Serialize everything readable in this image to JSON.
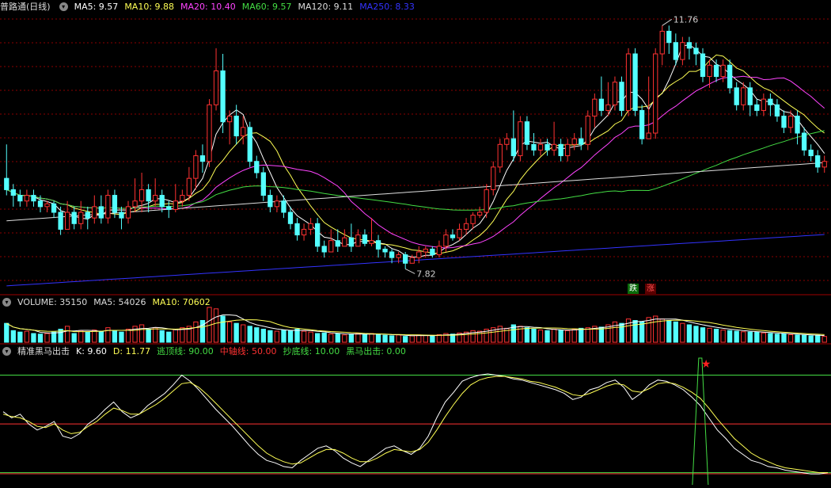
{
  "main": {
    "name": "普路通(日线)",
    "ma": [
      {
        "label": "MA5: 9.57",
        "color": "#ffffff"
      },
      {
        "label": "MA10: 9.88",
        "color": "#ffff55"
      },
      {
        "label": "MA20: 10.40",
        "color": "#ff44ff"
      },
      {
        "label": "MA60: 9.57",
        "color": "#44dd44"
      },
      {
        "label": "MA120: 9.11",
        "color": "#dddddd"
      },
      {
        "label": "MA250: 8.33",
        "color": "#3333ff"
      }
    ],
    "high_label": "11.76",
    "low_label": "7.82"
  },
  "volume": {
    "label": "VOLUME: 35150",
    "ma5": "MA5: 54026",
    "ma10": "MA10: 70602"
  },
  "indicator": {
    "name": "精准黑马出击",
    "k": "K: 9.60",
    "d": "D: 11.77",
    "top": "逃顶线: 90.00",
    "mid": "中轴线: 50.00",
    "bottom": "抄底线: 10.00",
    "signal": "黑马出击: 0.00"
  },
  "badges": {
    "down": "跌",
    "up": "涨"
  },
  "colors": {
    "up": "#ff3232",
    "down": "#54ffff",
    "grid": "#8b0000",
    "bg": "#000000"
  },
  "chart_data": {
    "type": "candlestick",
    "ylim": [
      7.2,
      12.1
    ],
    "candles": [
      [
        9.2,
        9.0,
        9.8,
        8.9
      ],
      [
        9.0,
        8.9,
        9.1,
        8.7
      ],
      [
        8.9,
        8.8,
        9.0,
        8.7
      ],
      [
        8.8,
        8.9,
        9.0,
        8.7
      ],
      [
        8.9,
        8.8,
        9.0,
        8.7
      ],
      [
        8.8,
        8.7,
        8.9,
        8.6
      ],
      [
        8.7,
        8.75,
        8.8,
        8.6
      ],
      [
        8.75,
        8.6,
        8.8,
        8.5
      ],
      [
        8.6,
        8.3,
        8.7,
        8.2
      ],
      [
        8.3,
        8.6,
        8.8,
        8.3
      ],
      [
        8.6,
        8.4,
        8.7,
        8.3
      ],
      [
        8.4,
        8.6,
        8.8,
        8.3
      ],
      [
        8.6,
        8.5,
        8.7,
        8.3
      ],
      [
        8.5,
        8.7,
        8.9,
        8.4
      ],
      [
        8.7,
        8.5,
        8.9,
        8.4
      ],
      [
        8.5,
        8.9,
        9.0,
        8.4
      ],
      [
        8.9,
        8.6,
        9.0,
        8.5
      ],
      [
        8.6,
        8.5,
        8.7,
        8.3
      ],
      [
        8.5,
        8.7,
        8.8,
        8.4
      ],
      [
        8.7,
        8.8,
        9.2,
        8.6
      ],
      [
        8.8,
        9.0,
        9.3,
        8.6
      ],
      [
        9.0,
        8.8,
        9.1,
        8.6
      ],
      [
        8.8,
        8.9,
        9.2,
        8.7
      ],
      [
        8.9,
        8.7,
        9.0,
        8.6
      ],
      [
        8.7,
        8.65,
        8.8,
        8.5
      ],
      [
        8.65,
        8.8,
        9.1,
        8.6
      ],
      [
        8.8,
        8.9,
        9.0,
        8.7
      ],
      [
        8.9,
        9.2,
        9.4,
        8.8
      ],
      [
        9.2,
        9.6,
        9.7,
        9.0
      ],
      [
        9.6,
        9.5,
        9.8,
        9.3
      ],
      [
        9.5,
        10.5,
        10.6,
        9.4
      ],
      [
        10.5,
        11.1,
        11.5,
        10.4
      ],
      [
        11.1,
        10.2,
        11.4,
        10.0
      ],
      [
        10.2,
        10.3,
        10.4,
        9.8
      ],
      [
        10.3,
        9.95,
        10.5,
        9.8
      ],
      [
        9.95,
        10.1,
        10.3,
        9.8
      ],
      [
        10.1,
        9.5,
        10.2,
        9.4
      ],
      [
        9.5,
        9.3,
        9.6,
        9.2
      ],
      [
        9.3,
        8.9,
        9.4,
        8.8
      ],
      [
        8.9,
        8.7,
        9.0,
        8.6
      ],
      [
        8.7,
        8.8,
        8.9,
        8.6
      ],
      [
        8.8,
        8.6,
        8.9,
        8.5
      ],
      [
        8.6,
        8.4,
        8.7,
        8.3
      ],
      [
        8.4,
        8.2,
        8.5,
        8.1
      ],
      [
        8.2,
        8.3,
        8.4,
        8.1
      ],
      [
        8.3,
        8.4,
        8.5,
        8.2
      ],
      [
        8.4,
        8.0,
        8.5,
        7.9
      ],
      [
        8.0,
        7.9,
        8.1,
        7.8
      ],
      [
        7.9,
        8.1,
        8.3,
        7.9
      ],
      [
        8.1,
        8.0,
        8.3,
        7.9
      ],
      [
        8.0,
        8.15,
        8.3,
        8.0
      ],
      [
        8.15,
        8.0,
        8.4,
        7.9
      ],
      [
        8.0,
        8.2,
        8.3,
        8.0
      ],
      [
        8.2,
        8.05,
        8.3,
        8.0
      ],
      [
        8.05,
        8.1,
        8.5,
        8.0
      ],
      [
        8.1,
        7.95,
        8.2,
        7.8
      ],
      [
        7.95,
        7.9,
        8.0,
        7.8
      ],
      [
        7.9,
        7.8,
        7.95,
        7.7
      ],
      [
        7.8,
        7.85,
        7.9,
        7.7
      ],
      [
        7.85,
        7.7,
        7.9,
        7.6
      ],
      [
        7.7,
        7.8,
        7.85,
        7.7
      ],
      [
        7.8,
        7.9,
        8.0,
        7.7
      ],
      [
        7.9,
        7.95,
        8.0,
        7.8
      ],
      [
        7.95,
        7.85,
        8.0,
        7.8
      ],
      [
        7.85,
        8.0,
        8.1,
        7.8
      ],
      [
        8.0,
        8.2,
        8.3,
        7.9
      ],
      [
        8.2,
        8.15,
        8.3,
        8.1
      ],
      [
        8.15,
        8.3,
        8.4,
        8.1
      ],
      [
        8.3,
        8.4,
        8.5,
        8.2
      ],
      [
        8.4,
        8.55,
        8.6,
        8.3
      ],
      [
        8.55,
        8.6,
        8.7,
        8.5
      ],
      [
        8.6,
        9.0,
        9.1,
        8.5
      ],
      [
        9.0,
        9.4,
        9.5,
        8.9
      ],
      [
        9.4,
        9.8,
        9.9,
        9.3
      ],
      [
        9.8,
        9.9,
        10.0,
        9.7
      ],
      [
        9.9,
        9.6,
        10.4,
        9.5
      ],
      [
        9.6,
        10.2,
        10.3,
        9.5
      ],
      [
        10.2,
        9.8,
        10.3,
        9.7
      ],
      [
        9.8,
        9.7,
        10.0,
        9.6
      ],
      [
        9.7,
        9.8,
        9.9,
        9.6
      ],
      [
        9.8,
        9.7,
        9.9,
        9.6
      ],
      [
        9.7,
        9.8,
        10.2,
        9.6
      ],
      [
        9.8,
        9.6,
        9.9,
        9.5
      ],
      [
        9.6,
        9.8,
        9.9,
        9.5
      ],
      [
        9.8,
        9.9,
        10.0,
        9.7
      ],
      [
        9.9,
        9.8,
        10.1,
        9.7
      ],
      [
        9.8,
        10.3,
        10.4,
        9.7
      ],
      [
        10.3,
        10.6,
        10.7,
        10.1
      ],
      [
        10.6,
        10.4,
        11.0,
        10.3
      ],
      [
        10.4,
        10.5,
        10.9,
        10.3
      ],
      [
        10.5,
        10.9,
        11.0,
        10.4
      ],
      [
        10.9,
        10.4,
        11.0,
        10.3
      ],
      [
        10.4,
        11.4,
        11.5,
        10.3
      ],
      [
        11.4,
        10.4,
        11.5,
        10.3
      ],
      [
        10.4,
        9.9,
        10.5,
        9.8
      ],
      [
        9.9,
        10.0,
        11.0,
        9.9
      ],
      [
        10.0,
        11.4,
        11.5,
        9.9
      ],
      [
        11.4,
        11.8,
        11.9,
        11.2
      ],
      [
        11.8,
        11.6,
        11.9,
        11.4
      ],
      [
        11.6,
        11.3,
        11.76,
        11.2
      ],
      [
        11.3,
        11.6,
        11.7,
        11.2
      ],
      [
        11.6,
        11.5,
        11.7,
        11.3
      ],
      [
        11.5,
        11.4,
        11.6,
        11.2
      ],
      [
        11.4,
        11.0,
        11.5,
        10.9
      ],
      [
        11.0,
        11.2,
        11.3,
        10.8
      ],
      [
        11.2,
        11.0,
        11.3,
        10.9
      ],
      [
        11.0,
        11.2,
        11.3,
        10.9
      ],
      [
        11.2,
        10.8,
        11.3,
        10.7
      ],
      [
        10.8,
        10.5,
        10.9,
        10.4
      ],
      [
        10.5,
        10.8,
        10.9,
        10.4
      ],
      [
        10.8,
        10.5,
        10.9,
        10.3
      ],
      [
        10.5,
        10.4,
        10.6,
        10.3
      ],
      [
        10.4,
        10.6,
        10.7,
        10.3
      ],
      [
        10.6,
        10.5,
        10.7,
        10.3
      ],
      [
        10.5,
        10.3,
        10.6,
        10.2
      ],
      [
        10.3,
        10.1,
        10.4,
        10.0
      ],
      [
        10.1,
        10.3,
        10.4,
        10.0
      ],
      [
        10.3,
        10.0,
        10.4,
        9.8
      ],
      [
        10.0,
        9.7,
        10.1,
        9.6
      ],
      [
        9.7,
        9.6,
        9.8,
        9.5
      ],
      [
        9.6,
        9.4,
        9.7,
        9.3
      ],
      [
        9.4,
        9.5,
        9.6,
        9.3
      ]
    ],
    "ma_colors": [
      "#ffffff",
      "#ffff55",
      "#ff44ff",
      "#44dd44",
      "#dddddd",
      "#3333ff"
    ],
    "volume_values": [
      65,
      40,
      35,
      38,
      30,
      28,
      30,
      35,
      45,
      55,
      30,
      40,
      35,
      42,
      38,
      50,
      40,
      35,
      45,
      55,
      60,
      45,
      50,
      40,
      35,
      45,
      50,
      55,
      70,
      75,
      120,
      115,
      90,
      70,
      65,
      60,
      55,
      50,
      45,
      40,
      38,
      42,
      40,
      45,
      38,
      35,
      30,
      32,
      28,
      30,
      25,
      28,
      30,
      26,
      30,
      28,
      24,
      22,
      25,
      20,
      22,
      25,
      24,
      22,
      26,
      30,
      28,
      32,
      35,
      40,
      38,
      45,
      50,
      55,
      48,
      60,
      55,
      50,
      45,
      42,
      40,
      45,
      42,
      40,
      45,
      48,
      50,
      55,
      52,
      60,
      70,
      65,
      80,
      75,
      70,
      85,
      90,
      80,
      75,
      70,
      65,
      60,
      55,
      50,
      48,
      45,
      42,
      40,
      38,
      36,
      35,
      34,
      32,
      30,
      28,
      30,
      26,
      25,
      24,
      22,
      24,
      20
    ],
    "k_values": [
      60,
      55,
      58,
      50,
      45,
      48,
      52,
      40,
      38,
      42,
      50,
      55,
      62,
      68,
      60,
      55,
      58,
      65,
      70,
      75,
      82,
      90,
      85,
      78,
      70,
      62,
      55,
      48,
      40,
      32,
      25,
      20,
      18,
      15,
      14,
      20,
      25,
      30,
      32,
      28,
      22,
      18,
      15,
      20,
      25,
      30,
      32,
      28,
      25,
      30,
      40,
      55,
      68,
      76,
      85,
      88,
      90,
      91,
      90,
      89,
      87,
      86,
      84,
      82,
      80,
      78,
      75,
      70,
      72,
      78,
      80,
      84,
      86,
      80,
      70,
      75,
      82,
      86,
      85,
      82,
      78,
      72,
      65,
      55,
      45,
      38,
      30,
      25,
      20,
      18,
      15,
      14,
      12,
      11,
      10,
      9,
      9,
      10
    ],
    "d_values": [
      58,
      56,
      55,
      52,
      48,
      47,
      50,
      45,
      42,
      43,
      48,
      52,
      58,
      63,
      61,
      58,
      58,
      62,
      66,
      71,
      77,
      83,
      84,
      80,
      74,
      67,
      60,
      53,
      46,
      39,
      32,
      26,
      22,
      19,
      17,
      18,
      22,
      26,
      29,
      29,
      26,
      22,
      19,
      19,
      22,
      26,
      29,
      28,
      27,
      29,
      35,
      45,
      56,
      66,
      75,
      82,
      86,
      88,
      89,
      89,
      88,
      87,
      85,
      84,
      82,
      80,
      77,
      74,
      73,
      75,
      78,
      81,
      83,
      82,
      77,
      76,
      79,
      83,
      84,
      83,
      80,
      76,
      71,
      63,
      54,
      46,
      38,
      32,
      26,
      22,
      19,
      16,
      14,
      13,
      12,
      11,
      10,
      10
    ],
    "signal_index": 82,
    "levels": [
      90,
      50,
      10
    ]
  }
}
